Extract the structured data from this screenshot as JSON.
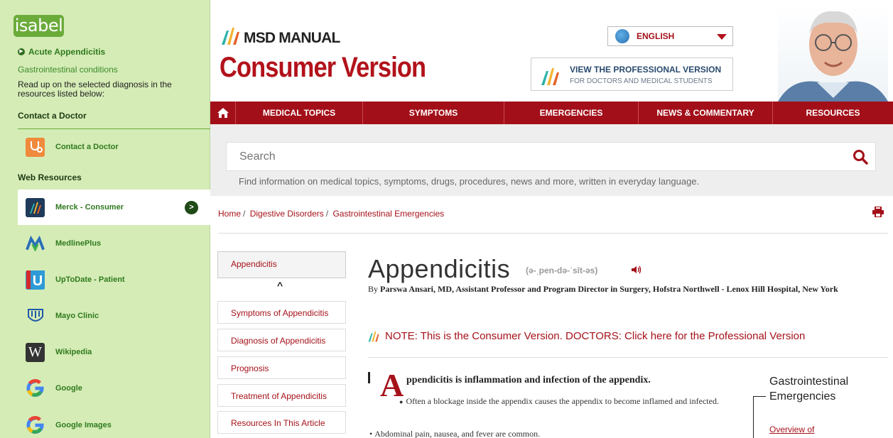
{
  "sidebar": {
    "logo": "isabel",
    "diagnosis": "Acute Appendicitis",
    "category": "Gastrointestinal conditions",
    "description": "Read up on the selected diagnosis in the resources listed below:",
    "contact_heading": "Contact a Doctor",
    "contact_item": "Contact a Doctor",
    "web_heading": "Web Resources",
    "items": [
      {
        "label": "Merck - Consumer",
        "icon": "merck-icon",
        "active": true
      },
      {
        "label": "MedlinePlus",
        "icon": "medlineplus-icon"
      },
      {
        "label": "UpToDate - Patient",
        "icon": "uptodate-icon"
      },
      {
        "label": "Mayo Clinic",
        "icon": "mayo-icon"
      },
      {
        "label": "Wikipedia",
        "icon": "wikipedia-icon"
      },
      {
        "label": "Google",
        "icon": "google-icon"
      },
      {
        "label": "Google Images",
        "icon": "google-images-icon"
      }
    ],
    "go_label": ">"
  },
  "header": {
    "brand_top": "MSD MANUAL",
    "brand_main": "Consumer Version",
    "language": "ENGLISH",
    "pro_title": "VIEW THE PROFESSIONAL VERSION",
    "pro_sub": "FOR DOCTORS AND MEDICAL STUDENTS"
  },
  "nav": {
    "items": [
      "MEDICAL TOPICS",
      "SYMPTOMS",
      "EMERGENCIES",
      "NEWS & COMMENTARY",
      "RESOURCES"
    ]
  },
  "search": {
    "placeholder": "Search",
    "hint": "Find information on medical topics, symptoms, drugs, procedures, news and more, written in everyday language."
  },
  "breadcrumb": [
    "Home",
    "Digestive Disorders",
    "Gastrointestinal Emergencies"
  ],
  "article_nav": {
    "current": "Appendicitis",
    "links": [
      "Symptoms of Appendicitis",
      "Diagnosis of Appendicitis",
      "Prognosis",
      "Treatment of Appendicitis",
      "Resources In This Article"
    ]
  },
  "article": {
    "title": "Appendicitis",
    "pronunciation": "(ə-ˌpen-də-ˈsīt-əs)",
    "by": "By",
    "author": "Parswa Ansari, MD, Assistant Professor and Program Director in Surgery, Hofstra Northwell - Lenox Hill Hospital, New York",
    "note": "NOTE: This is the Consumer Version. DOCTORS: Click here for the Professional Version",
    "dropcap": "A",
    "lead": "ppendicitis is inflammation and infection of the appendix.",
    "bullet1": "Often a blockage inside the appendix causes the appendix to become inflamed and infected.",
    "bullet2": "Abdominal pain, nausea, and fever are common."
  },
  "related": {
    "title": "Gastrointestinal Emergencies",
    "link": "Overview of"
  },
  "colors": {
    "brand_red": "#a30f19",
    "sidebar_green": "#d5ecb6",
    "isabel_green": "#6bab3a"
  }
}
